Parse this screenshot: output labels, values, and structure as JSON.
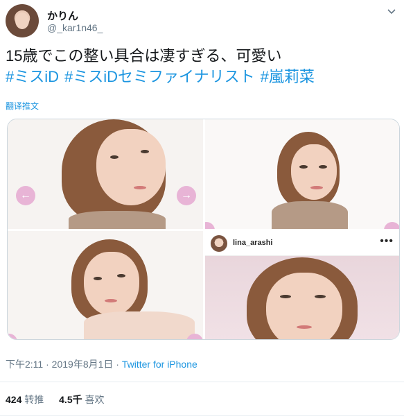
{
  "user": {
    "display_name": "かりん",
    "handle": "@_kar1n46_"
  },
  "tweet": {
    "text": "15歳でこの整い具合は凄すぎる、可愛い",
    "hashtags": [
      "#ミスiD",
      "#ミスiDセミファイナリスト",
      "#嵐莉菜"
    ],
    "translate_label": "翻译推文"
  },
  "media": {
    "instagram_username": "lina_arashi",
    "more_glyph": "•••"
  },
  "meta": {
    "time": "下午2:11",
    "date": "2019年8月1日",
    "separator": "·",
    "source": "Twitter for iPhone"
  },
  "stats": {
    "retweets_count": "424",
    "retweets_label": "转推",
    "likes_count": "4.5千",
    "likes_label": "喜欢"
  },
  "icons": {
    "caret": "chevron-down-icon",
    "arrow_left": "arrow-left-icon",
    "arrow_right": "arrow-right-icon"
  },
  "colors": {
    "link": "#1b95e0",
    "secondary_text": "#657786",
    "carousel_button": "#e8b4d6"
  }
}
